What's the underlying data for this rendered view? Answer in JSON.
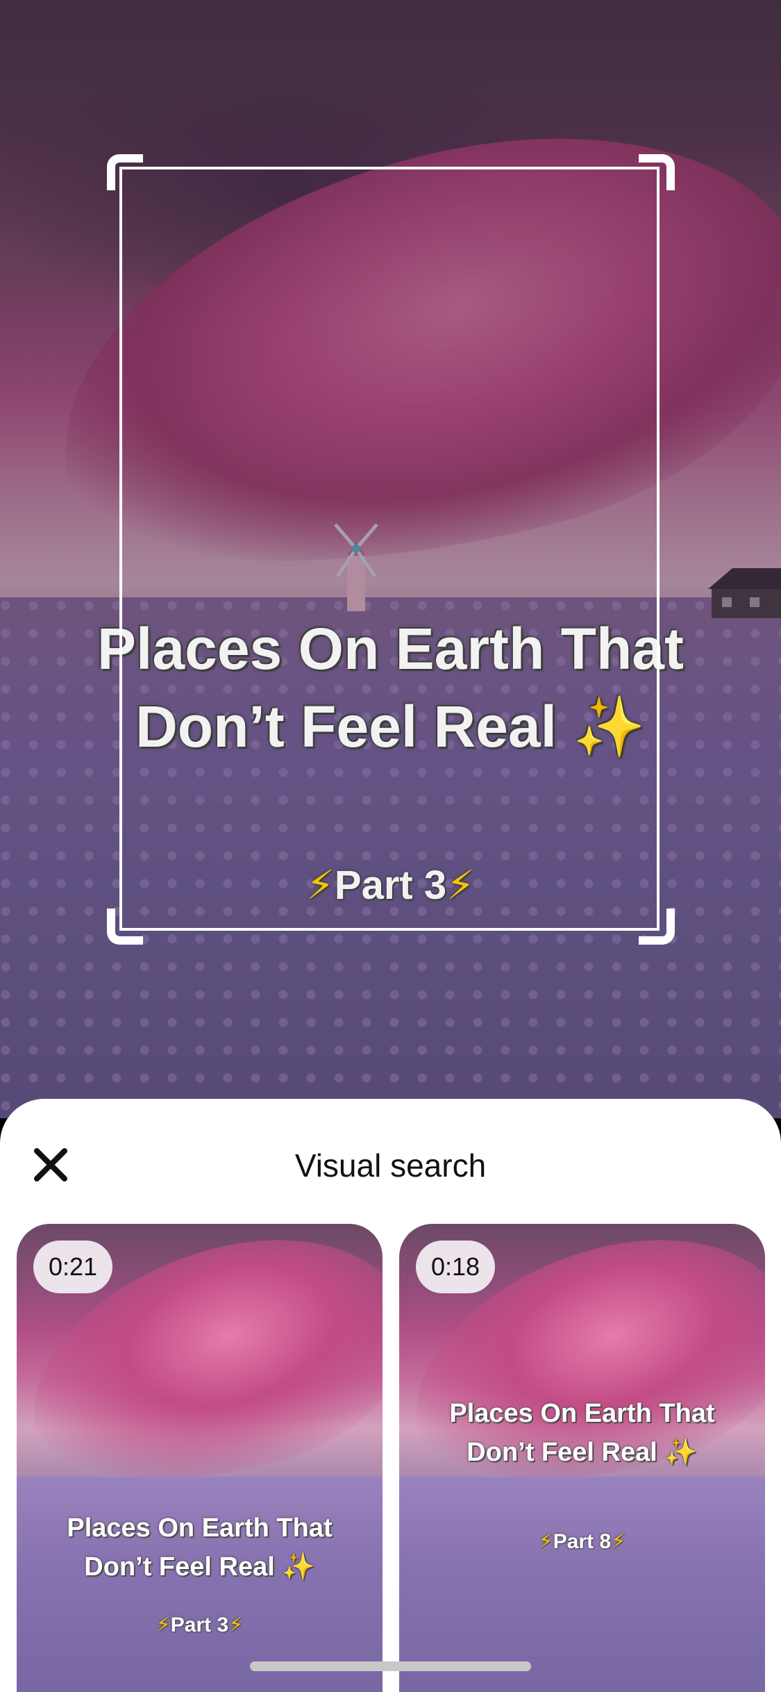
{
  "hero": {
    "overlay_title_line1": "Places On Earth That",
    "overlay_title_line2": "Don’t Feel Real",
    "sparkle_icon": "✨",
    "part_label": "Part 3",
    "bolt_icon": "⚡"
  },
  "sheet": {
    "title": "Visual search",
    "close_icon": "close-icon"
  },
  "results": [
    {
      "duration": "0:21",
      "title_line1": "Places On Earth That",
      "title_line2": "Don’t Feel Real",
      "part_label": "Part 3"
    },
    {
      "duration": "0:18",
      "title_line1": "Places On Earth That",
      "title_line2": "Don’t Feel Real",
      "part_label": "Part 8"
    }
  ],
  "colors": {
    "sheet_background": "#ffffff",
    "title_text": "#111111",
    "sparkle": "#f7d33a",
    "bolt": "#f5c400",
    "home_indicator": "#c8c8c8"
  }
}
